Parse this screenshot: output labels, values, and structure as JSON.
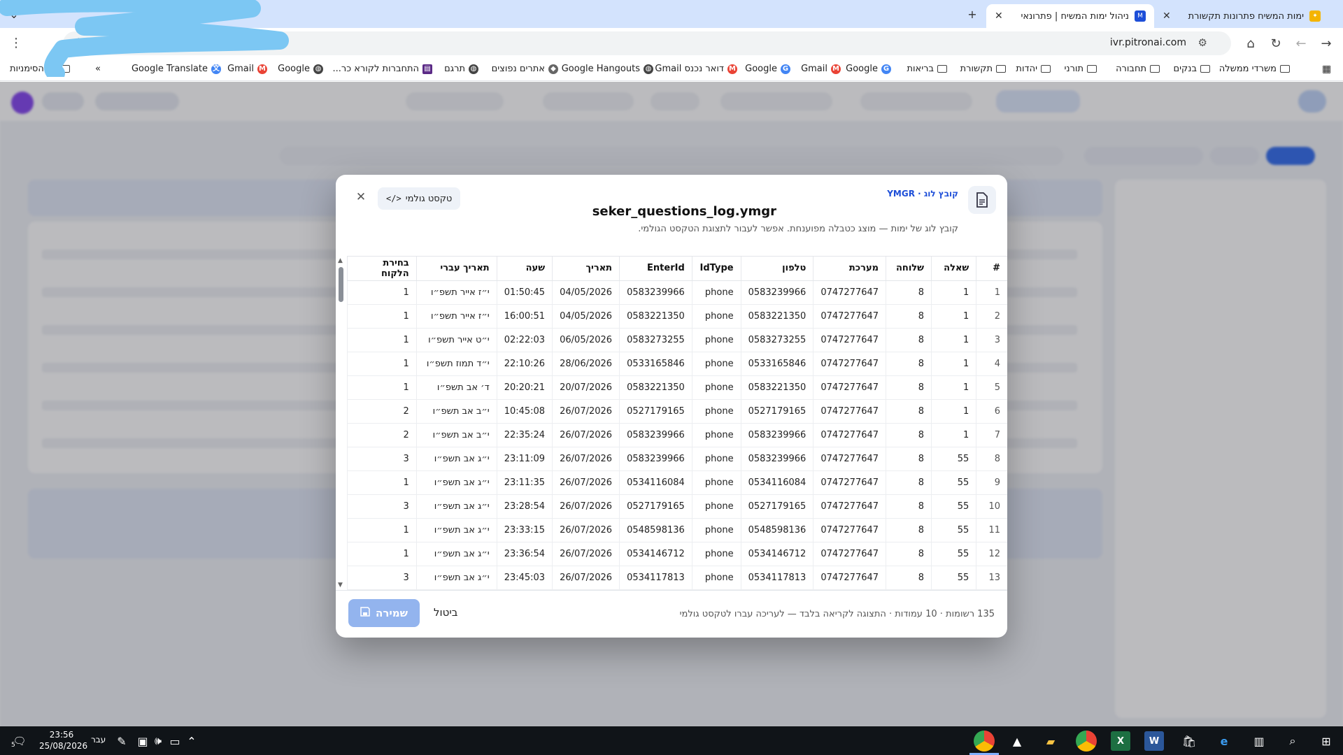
{
  "browser": {
    "tabs": [
      {
        "title": "ימות המשיח פתרונות תקשורת",
        "active": false,
        "fav_color": "#f4b400"
      },
      {
        "title": "ניהול ימות המשיח | פתרונאי",
        "active": true,
        "fav_text": "M",
        "fav_color": "#1d4ed8"
      }
    ],
    "url": "ivr.pitronai.com",
    "bookmarks": [
      "משרדי ממשלה",
      "בנקים",
      "תחבורה",
      "תורני",
      "יהדות",
      "תקשורת",
      "בריאות",
      "Google",
      "Gmail",
      "Google",
      "דואר נכנס Gmail",
      "Google Hangouts",
      "אתרים נפוצים",
      "תרגם",
      "התחברות לקורא כר...",
      "Google",
      "Gmail",
      "Google Translate"
    ],
    "all_bookmarks": "כל הסימניות",
    "more_bookmarks": "»"
  },
  "modal": {
    "kind_label": "קובץ לוג · YMGR",
    "filename": "seker_questions_log.ymgr",
    "subtitle": "קובץ לוג של ימות — מוצג כטבלה מפוענחת. אפשר לעבור לתצוגת הטקסט הגולמי.",
    "raw_button": "טקסט גולמי",
    "columns": [
      "#",
      "שאלה",
      "שלוחה",
      "מערכת",
      "טלפון",
      "IdType",
      "EnterId",
      "תאריך",
      "שעה",
      "תאריך עברי",
      "בחירת הלקוח"
    ],
    "rows": [
      [
        "1",
        "1",
        "8",
        "0747277647",
        "0583239966",
        "phone",
        "0583239966",
        "04/05/2026",
        "01:50:45",
        "י״ז אייר תשפ״ו",
        "1"
      ],
      [
        "2",
        "1",
        "8",
        "0747277647",
        "0583221350",
        "phone",
        "0583221350",
        "04/05/2026",
        "16:00:51",
        "י״ז אייר תשפ״ו",
        "1"
      ],
      [
        "3",
        "1",
        "8",
        "0747277647",
        "0583273255",
        "phone",
        "0583273255",
        "06/05/2026",
        "02:22:03",
        "י״ט אייר תשפ״ו",
        "1"
      ],
      [
        "4",
        "1",
        "8",
        "0747277647",
        "0533165846",
        "phone",
        "0533165846",
        "28/06/2026",
        "22:10:26",
        "י״ד תמוז תשפ״ו",
        "1"
      ],
      [
        "5",
        "1",
        "8",
        "0747277647",
        "0583221350",
        "phone",
        "0583221350",
        "20/07/2026",
        "20:20:21",
        "ד׳ אב תשפ״ו",
        "1"
      ],
      [
        "6",
        "1",
        "8",
        "0747277647",
        "0527179165",
        "phone",
        "0527179165",
        "26/07/2026",
        "10:45:08",
        "י״ב אב תשפ״ו",
        "2"
      ],
      [
        "7",
        "1",
        "8",
        "0747277647",
        "0583239966",
        "phone",
        "0583239966",
        "26/07/2026",
        "22:35:24",
        "י״ב אב תשפ״ו",
        "2"
      ],
      [
        "8",
        "55",
        "8",
        "0747277647",
        "0583239966",
        "phone",
        "0583239966",
        "26/07/2026",
        "23:11:09",
        "י״ג אב תשפ״ו",
        "3"
      ],
      [
        "9",
        "55",
        "8",
        "0747277647",
        "0534116084",
        "phone",
        "0534116084",
        "26/07/2026",
        "23:11:35",
        "י״ג אב תשפ״ו",
        "1"
      ],
      [
        "10",
        "55",
        "8",
        "0747277647",
        "0527179165",
        "phone",
        "0527179165",
        "26/07/2026",
        "23:28:54",
        "י״ג אב תשפ״ו",
        "3"
      ],
      [
        "11",
        "55",
        "8",
        "0747277647",
        "0548598136",
        "phone",
        "0548598136",
        "26/07/2026",
        "23:33:15",
        "י״ג אב תשפ״ו",
        "1"
      ],
      [
        "12",
        "55",
        "8",
        "0747277647",
        "0534146712",
        "phone",
        "0534146712",
        "26/07/2026",
        "23:36:54",
        "י״ג אב תשפ״ו",
        "1"
      ],
      [
        "13",
        "55",
        "8",
        "0747277647",
        "0534117813",
        "phone",
        "0534117813",
        "26/07/2026",
        "23:45:03",
        "י״ג אב תשפ״ו",
        "3"
      ]
    ],
    "status": "135 רשומות · 10 עמודות · התצוגה לקריאה בלבד — לעריכה עברו לטקסט גולמי",
    "cancel": "ביטול",
    "save": "שמירה"
  },
  "taskbar": {
    "time": "23:56",
    "date": "25/08/2026",
    "lang": "עבר",
    "notif_count": "5"
  },
  "colors": {
    "accent": "#1d4ed8",
    "save_disabled": "#93b4ee",
    "tabstrip": "#d3e3fd"
  }
}
